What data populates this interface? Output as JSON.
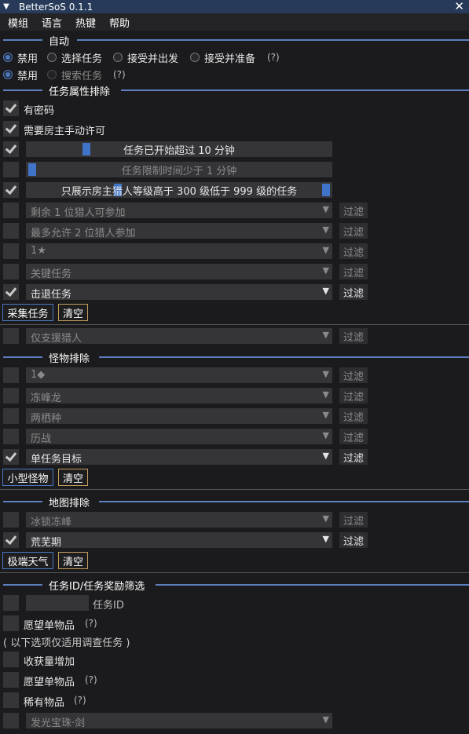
{
  "window": {
    "title": "BetterSoS 0.1.1"
  },
  "menu": [
    "模组",
    "语言",
    "热键",
    "帮助"
  ],
  "sections": {
    "auto": "自动",
    "quest_attr": "任务属性排除",
    "monster": "怪物排除",
    "map": "地图排除",
    "quest_id": "任务ID/任务奖励筛选"
  },
  "auto": {
    "row1": [
      "禁用",
      "选择任务",
      "接受并出发",
      "接受并准备"
    ],
    "row2": [
      "禁用",
      "搜索任务"
    ],
    "help": "(?)"
  },
  "quest_checks": {
    "password": "有密码",
    "host_permission": "需要房主手动许可"
  },
  "sliders": {
    "started": "任务已开始超过 10 分钟",
    "time_limit": "任务限制时间少于 1 分钟",
    "hunter_rank": "只展示房主猎人等级高于 300 级低于 999 级的任务"
  },
  "filter_label": "过滤",
  "quest_combos": [
    "剩余 1 位猎人可参加",
    "最多允许 2 位猎人参加",
    "1★",
    "关键任务",
    "击退任务"
  ],
  "buttons": {
    "gather_quest": "采集任务",
    "clear": "清空",
    "small_monster": "小型怪物",
    "extreme_weather": "极端天气"
  },
  "support_combo": "仅支援猎人",
  "monster_combos": [
    "1◆",
    "冻峰龙",
    "两栖种",
    "历战",
    "单任务目标"
  ],
  "map_combos": [
    "冰锁冻峰",
    "荒芜期"
  ],
  "quest_id": {
    "id_label": "任务ID",
    "wish_item": "愿望单物品",
    "help": "(?)",
    "investigation_note": "( 以下选项仅适用调查任务 )",
    "harvest_increase": "收获量增加",
    "wish_item2": "愿望单物品",
    "rare_item": "稀有物品",
    "reward_combo": "发光宝珠·剑"
  },
  "colors": {
    "accent": "#4a79c7",
    "title_bg": "#273a5a",
    "bg": "#1b1b1d",
    "gold": "#c39e5c"
  }
}
